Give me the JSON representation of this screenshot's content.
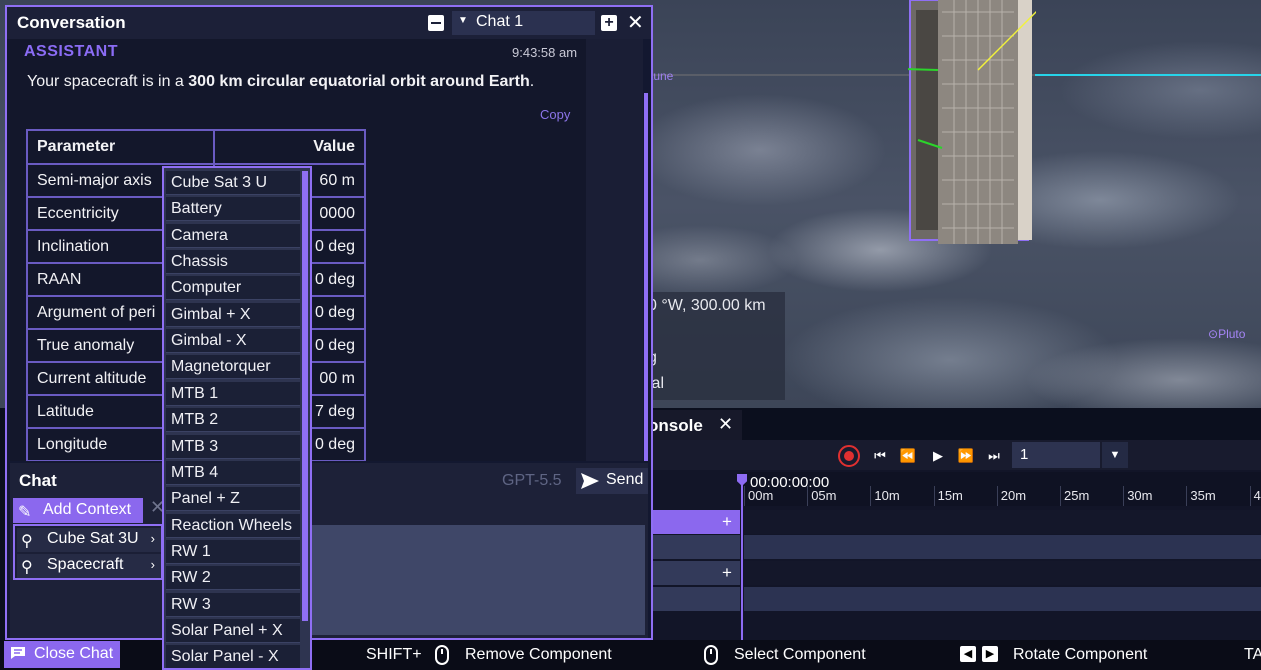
{
  "viewport": {
    "neptune_label": "tune",
    "pluto_label": "Pluto",
    "info_lines": [
      "0 °W, 300.00 km",
      "g",
      "ial"
    ]
  },
  "console": {
    "tab_label": "onsole",
    "frame_value": "1",
    "current_time": "00:00:00:00",
    "ticks": [
      "00m",
      "05m",
      "10m",
      "15m",
      "20m",
      "25m",
      "30m",
      "35m",
      "4"
    ]
  },
  "statusbar": {
    "close_chat": "Close Chat",
    "shift_label": "SHIFT+",
    "remove_component": "Remove Component",
    "select_component": "Select Component",
    "rotate_component": "Rotate Component",
    "overflow_label": "TA"
  },
  "conversation": {
    "title": "Conversation",
    "chat_selector": "Chat 1",
    "message": {
      "role": "ASSISTANT",
      "time": "9:43:58 am",
      "text_before": "Your spacecraft is in a ",
      "text_bold": "300 km circular equatorial orbit around Earth",
      "text_after": ".",
      "copy_label": "Copy"
    },
    "table": {
      "headers": [
        "Parameter",
        "Value"
      ],
      "rows": [
        [
          "Semi-major axis",
          "60 m"
        ],
        [
          "Eccentricity",
          "0000"
        ],
        [
          "Inclination",
          "0 deg"
        ],
        [
          "RAAN",
          "0 deg"
        ],
        [
          "Argument of peri",
          "0 deg"
        ],
        [
          "True anomaly",
          "0 deg"
        ],
        [
          "Current altitude",
          "00 m"
        ],
        [
          "Latitude",
          "7 deg"
        ],
        [
          "Longitude",
          "0 deg"
        ]
      ]
    }
  },
  "chat": {
    "label": "Chat",
    "model": "GPT-5.5",
    "send_label": "Send",
    "add_context_label": "Add Context",
    "context_items": [
      {
        "label": "Cube Sat 3U",
        "chevron": "›"
      },
      {
        "label": "Spacecraft",
        "chevron": "›"
      }
    ]
  },
  "component_menu": {
    "items": [
      "Cube Sat 3 U",
      "Battery",
      "Camera",
      "Chassis",
      "Computer",
      "Gimbal + X",
      "Gimbal - X",
      "Magnetorquer",
      "MTB 1",
      "MTB 2",
      "MTB 3",
      "MTB 4",
      "Panel + Z",
      "Reaction Wheels",
      "RW 1",
      "RW 2",
      "RW 3",
      "Solar Panel + X",
      "Solar Panel - X"
    ]
  },
  "colors": {
    "accent": "#8f6ff4",
    "record": "#e03030",
    "orbit_cyan": "#27d4ea"
  }
}
